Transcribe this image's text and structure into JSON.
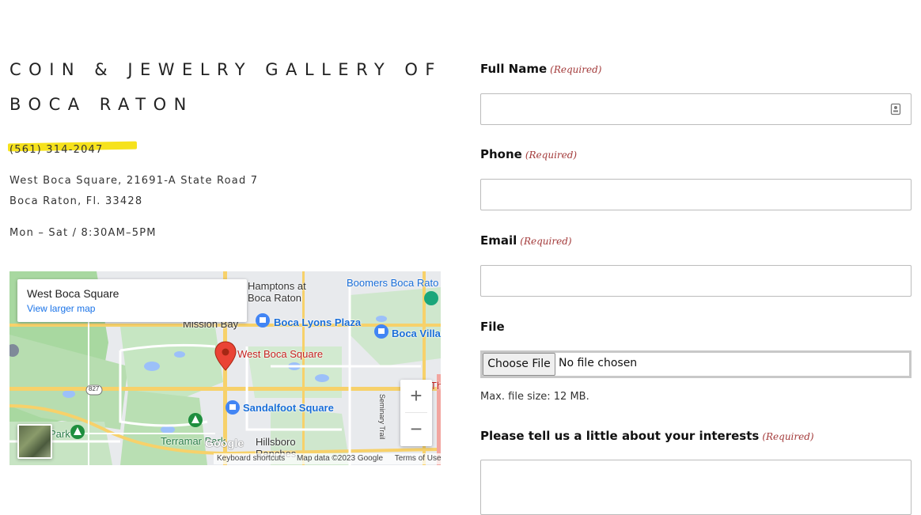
{
  "business": {
    "name": "COIN & JEWELRY GALLERY OF BOCA RATON",
    "phone": "(561) 314-2047",
    "address_line1": "West Boca Square, 21691-A State Road 7",
    "address_line2": "Boca Raton, Fl. 33428",
    "hours": "Mon – Sat / 8:30AM–5PM"
  },
  "map": {
    "card_title": "West Boca Square",
    "card_link": "View larger map",
    "labels": {
      "hamptons": "Hamptons at\nBoca Raton",
      "boomers": "Boomers Boca Rato",
      "mission_bay": "Mission Bay",
      "boca_lyons": "Boca Lyons Plaza",
      "boca_villa": "Boca Villa",
      "west_boca": "West Boca Square",
      "sandalfoot": "Sandalfoot Square",
      "terramar": "Terramar Park",
      "park": "Park",
      "hillsboro": "Hillsboro\nRanches",
      "route": "827",
      "seminary": "Seminary Trail",
      "th": "Th"
    },
    "zoom_in": "+",
    "zoom_out": "−",
    "google": "Google",
    "attribution": {
      "shortcuts": "Keyboard shortcuts",
      "data": "Map data ©2023 Google",
      "terms": "Terms of Use"
    }
  },
  "form": {
    "required_text": "(Required)",
    "full_name": {
      "label": "Full Name",
      "value": ""
    },
    "phone": {
      "label": "Phone",
      "value": ""
    },
    "email": {
      "label": "Email",
      "value": ""
    },
    "file": {
      "label": "File",
      "button": "Choose File",
      "status": "No file chosen",
      "hint": "Max. file size: 12 MB."
    },
    "interests": {
      "label": "Please tell us a little about your interests"
    }
  },
  "colors": {
    "highlight": "#f6e21c",
    "required": "#a33a3a",
    "map_link": "#1a73e8",
    "pin": "#ea4335"
  }
}
